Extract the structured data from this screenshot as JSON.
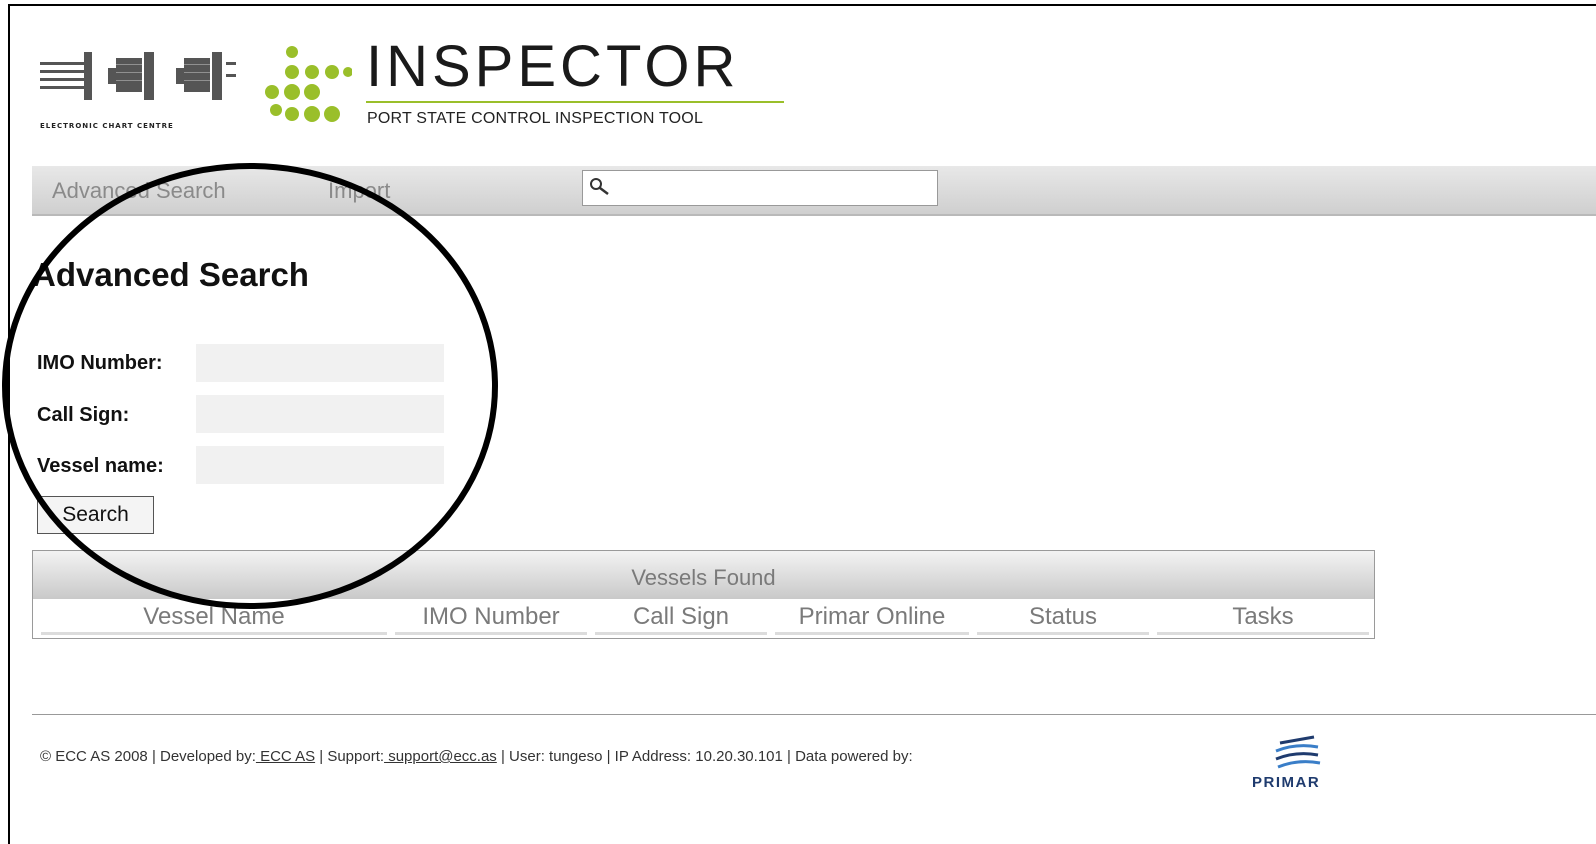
{
  "header": {
    "brand_title": "INSPECTOR",
    "brand_subtitle": "PORT STATE CONTROL INSPECTION TOOL",
    "ecc_caption": "ELECTRONIC CHART CENTRE"
  },
  "nav": {
    "items": [
      "Advanced Search",
      "Import"
    ],
    "search_value": "",
    "search_icon": "magnifier-icon"
  },
  "page": {
    "title": "Advanced Search"
  },
  "form": {
    "imo_label": "IMO Number:",
    "imo_value": "",
    "callsign_label": "Call Sign:",
    "callsign_value": "",
    "vessel_label": "Vessel name:",
    "vessel_value": "",
    "search_button": "Search"
  },
  "results": {
    "caption": "Vessels Found",
    "columns": [
      "Vessel Name",
      "IMO Number",
      "Call Sign",
      "Primar Online",
      "Status",
      "Tasks"
    ],
    "rows": []
  },
  "footer": {
    "copyright": "© ECC AS 2008 | Developed by:",
    "developer_link": " ECC AS",
    "support_prefix": " | Support:",
    "support_link": " support@ecc.as",
    "user_info": " | User: tungeso | IP Address: 10.20.30.101 | Data powered by:",
    "partner_logo_text": "PRIMAR"
  },
  "colors": {
    "brand_green": "#9abf2a",
    "nav_text": "#8a8a8a",
    "primar_blue": "#1f3b6e"
  }
}
